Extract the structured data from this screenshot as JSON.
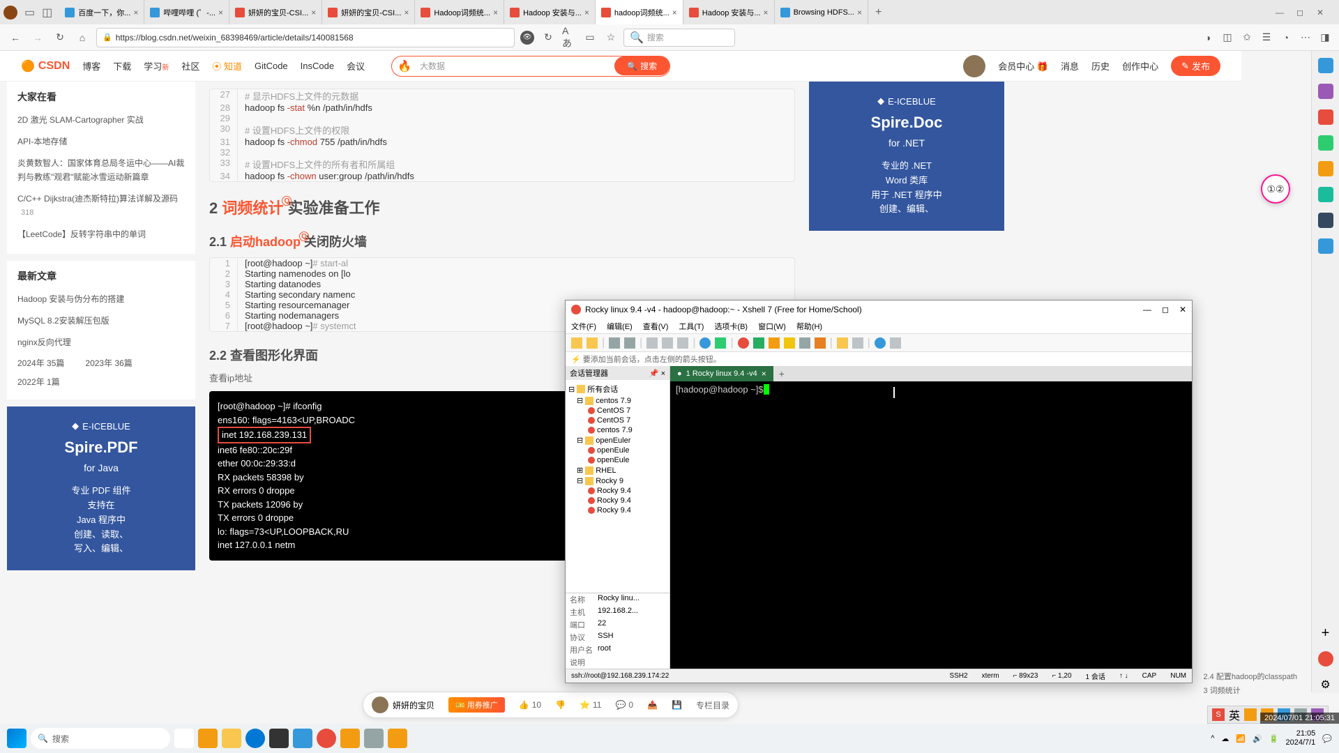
{
  "browser": {
    "tabs": [
      {
        "title": "百度一下，你...",
        "icon": "blue"
      },
      {
        "title": "哔哩哔哩 (゜-...",
        "icon": "blue"
      },
      {
        "title": "妍妍的宝贝-CSI...",
        "icon": "red"
      },
      {
        "title": "妍妍的宝贝-CSI...",
        "icon": "red"
      },
      {
        "title": "Hadoop词频统...",
        "icon": "red"
      },
      {
        "title": "Hadoop 安装与...",
        "icon": "red"
      },
      {
        "title": "hadoop词频统...",
        "icon": "red",
        "active": true
      },
      {
        "title": "Hadoop 安装与...",
        "icon": "red"
      },
      {
        "title": "Browsing HDFS...",
        "icon": "blue"
      }
    ],
    "url": "https://blog.csdn.net/weixin_68398469/article/details/140081568",
    "search_placeholder": "搜索"
  },
  "csdn": {
    "logo": "CSDN",
    "nav": [
      "博客",
      "下载",
      "学习",
      "社区",
      "知道",
      "GitCode",
      "InsCode",
      "会议"
    ],
    "search_text": "大数据",
    "search_btn": "搜索",
    "user_nav": [
      "会员中心 🎁",
      "消息",
      "历史",
      "创作中心"
    ],
    "publish": "发布"
  },
  "sidebar": {
    "section1_title": "大家在看",
    "section1_items": [
      {
        "text": "2D 激光 SLAM-Cartographer 实战"
      },
      {
        "text": "API-本地存储"
      },
      {
        "text": "炎黄数智人：国家体育总局冬运中心——AI裁判与教练\"观君\"赋能冰雪运动新篇章"
      },
      {
        "text": "C/C++ Dijkstra(迪杰斯特拉)算法详解及源码",
        "views": "318"
      },
      {
        "text": "【LeetCode】反转字符串中的单词"
      }
    ],
    "section2_title": "最新文章",
    "section2_items": [
      "Hadoop 安装与伪分布的搭建",
      "MySQL 8.2安装解压包版",
      "nginx反向代理"
    ],
    "year_stats": [
      {
        "year": "2024年",
        "count": "35篇"
      },
      {
        "year": "2023年",
        "count": "36篇"
      },
      {
        "year": "2022年",
        "count": "1篇"
      }
    ]
  },
  "article": {
    "code1": [
      {
        "num": "27",
        "comment": "# 显示HDFS上文件的元数据"
      },
      {
        "num": "28",
        "cmd": "hadoop fs ",
        "red": "-stat",
        "rest": " %n /path/in/hdfs"
      },
      {
        "num": "29",
        "cmd": ""
      },
      {
        "num": "30",
        "comment": "# 设置HDFS上文件的权限"
      },
      {
        "num": "31",
        "cmd": "hadoop fs ",
        "red": "-chmod",
        "rest": " 755 /path/in/hdfs"
      },
      {
        "num": "32",
        "cmd": ""
      },
      {
        "num": "33",
        "comment": "# 设置HDFS上文件的所有者和所属组"
      },
      {
        "num": "34",
        "cmd": "hadoop fs ",
        "red": "-chown",
        "rest": " user:group /path/in/hdfs"
      }
    ],
    "h2_1_prefix": "2 ",
    "h2_1_highlight": "词频统计",
    "h2_1_suffix": " 实验准备工作",
    "h2_2_prefix": "2.1 ",
    "h2_2_highlight": "启动hadoop",
    "h2_2_suffix": " 关闭防火墙",
    "code2": [
      {
        "num": "1",
        "text": "[root@hadoop ~]# start-al"
      },
      {
        "num": "2",
        "text": "Starting namenodes on [lo"
      },
      {
        "num": "3",
        "text": "Starting datanodes"
      },
      {
        "num": "4",
        "text": "Starting secondary namenc"
      },
      {
        "num": "5",
        "text": "Starting resourcemanager"
      },
      {
        "num": "6",
        "text": "Starting nodemanagers"
      },
      {
        "num": "7",
        "text": "[root@hadoop ~]# systemct"
      }
    ],
    "h2_3": "2.2 查看图形化界面",
    "desc_3": "查看ip地址",
    "terminal": {
      "line1": "[root@hadoop ~]# ifconfig",
      "line2": "ens160: flags=4163<UP,BROADC",
      "line3_pre": "        ",
      "line3_hl": "inet 192.168.239.131",
      "line4": "        inet6 fe80::20c:29f",
      "line5": "        ether 00:0c:29:33:d",
      "line6": "        RX packets 58398  by",
      "line7": "        RX errors 0  droppe",
      "line8": "        TX packets 12096  by",
      "line9": "        TX errors 0  droppe",
      "line10": "",
      "line11": "lo: flags=73<UP,LOOPBACK,RU",
      "line12": "        inet 127.0.0.1  netm"
    }
  },
  "footer": {
    "author": "妍妍的宝贝",
    "coupon": "🎫 用券推广",
    "like": "10",
    "dislike": "",
    "favorite": "11",
    "comment": "0",
    "catalog": "专栏目录"
  },
  "rightAd": {
    "brand": "E-ICEBLUE",
    "title": "Spire.Doc",
    "sub": "for .NET",
    "desc1": "专业的 .NET",
    "desc2": "Word 类库",
    "desc3": "用于 .NET 程序中",
    "desc4": "创建、编辑、"
  },
  "leftAd": {
    "brand": "E-ICEBLUE",
    "title": "Spire.PDF",
    "sub": "for Java",
    "desc1": "专业 PDF 组件",
    "desc2": "支持在",
    "desc3": "Java 程序中",
    "desc4": "创建、读取、",
    "desc5": "写入、编辑、"
  },
  "anchors": {
    "a1": "2.4 配置hadoop的classpath",
    "a2": "3 词频统计"
  },
  "xshell": {
    "title": "Rocky linux 9.4 -v4 - hadoop@hadoop:~ - Xshell 7 (Free for Home/School)",
    "menu": [
      "文件(F)",
      "编辑(E)",
      "查看(V)",
      "工具(T)",
      "选项卡(B)",
      "窗口(W)",
      "帮助(H)"
    ],
    "hint": "⚡ 要添加当前会话，点击左侧的箭头按钮。",
    "session_panel_title": "会话管理器",
    "tree": [
      {
        "label": "所有会话",
        "type": "folder",
        "indent": 0
      },
      {
        "label": "centos 7.9",
        "type": "folder",
        "indent": 1
      },
      {
        "label": "CentOS 7",
        "type": "session",
        "indent": 2
      },
      {
        "label": "CentOS 7",
        "type": "session",
        "indent": 2
      },
      {
        "label": "centos 7.9",
        "type": "session",
        "indent": 2
      },
      {
        "label": "openEuler",
        "type": "folder",
        "indent": 1
      },
      {
        "label": "openEule",
        "type": "session",
        "indent": 2
      },
      {
        "label": "openEule",
        "type": "session",
        "indent": 2
      },
      {
        "label": "RHEL",
        "type": "folder",
        "indent": 1
      },
      {
        "label": "Rocky 9",
        "type": "folder",
        "indent": 1
      },
      {
        "label": "Rocky 9.4",
        "type": "session",
        "indent": 2
      },
      {
        "label": "Rocky 9.4",
        "type": "session",
        "indent": 2
      },
      {
        "label": "Rocky 9.4",
        "type": "session",
        "indent": 2
      }
    ],
    "props": [
      {
        "label": "名称",
        "value": "Rocky linu..."
      },
      {
        "label": "主机",
        "value": "192.168.2..."
      },
      {
        "label": "端口",
        "value": "22"
      },
      {
        "label": "协议",
        "value": "SSH"
      },
      {
        "label": "用户名",
        "value": "root"
      },
      {
        "label": "说明",
        "value": ""
      }
    ],
    "tab_title": "1 Rocky linux 9.4 -v4",
    "prompt": "[hadoop@hadoop ~]$ ",
    "status_left": "ssh://root@192.168.239.174:22",
    "status_items": [
      "SSH2",
      "xterm",
      "⌐ 89x23",
      "⌐ 1,20",
      "1 会话",
      "↑ ↓",
      "CAP",
      "NUM"
    ]
  },
  "taskbar": {
    "search": "搜索",
    "time": "21:05",
    "date": "2024/7/1"
  },
  "timestamp": "2024/07/01 21:05:31",
  "ime_lang": "英"
}
